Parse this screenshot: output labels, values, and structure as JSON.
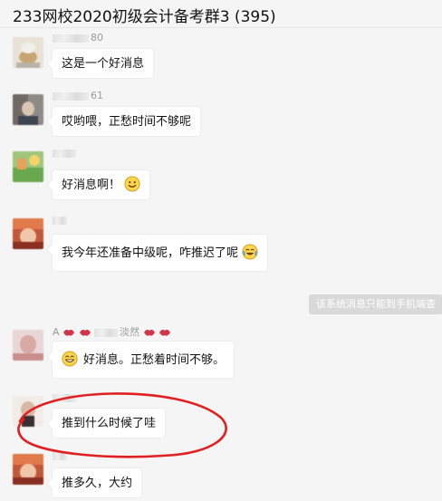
{
  "window": {
    "title": "233网校2020初级会计备考群3 (395)"
  },
  "messages": [
    {
      "nickname_suffix": "80",
      "text": "这是一个好消息"
    },
    {
      "nickname_suffix": "61",
      "text": "哎哟喂，正愁时间不够呢"
    },
    {
      "nickname_suffix": "",
      "text": "好消息啊！",
      "emoji": "smile-emoji"
    },
    {
      "nickname_suffix": "",
      "text": "我今年还准备中级呢，咋推迟了呢",
      "emoji": "laugh-cry-emoji"
    },
    {
      "nickname_prefix": "A",
      "nickname_middle": "淡然",
      "text": "好消息。正愁着时间不够。",
      "emoji": "grin-emoji"
    },
    {
      "nickname_suffix": "",
      "text": "推到什么时候了哇"
    },
    {
      "nickname_suffix": "",
      "text": "推多久，大约"
    }
  ],
  "system": {
    "text": "该系统消息只能到手机端查"
  },
  "annotation": {
    "color": "#e02020"
  }
}
